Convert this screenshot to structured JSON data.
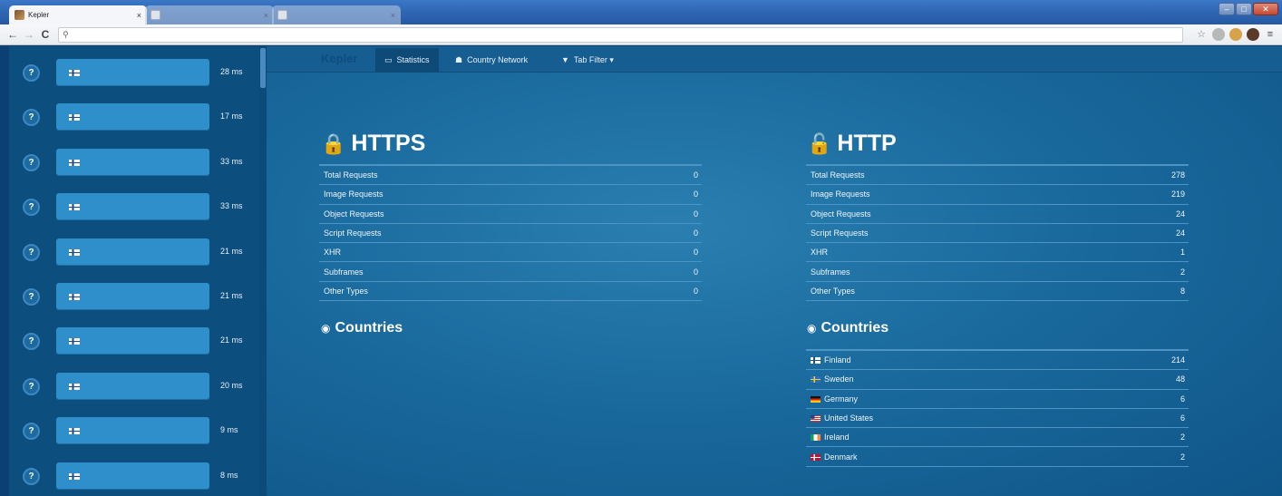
{
  "browser": {
    "tabs": [
      {
        "title": "Kepler",
        "close": "×"
      },
      {
        "title": "",
        "close": "×"
      },
      {
        "title": "",
        "close": "×"
      }
    ],
    "window_controls": {
      "minimize": "–",
      "maximize": "□",
      "close": "✕"
    },
    "nav": {
      "back": "←",
      "forward": "→",
      "reload": "C",
      "search_glyph": "⚲"
    },
    "toolbar_icons": {
      "star": "☆",
      "menu": "≡"
    }
  },
  "sidebar": {
    "help_glyph": "?",
    "requests": [
      {
        "time": "28 ms"
      },
      {
        "time": "17 ms"
      },
      {
        "time": "33 ms"
      },
      {
        "time": "33 ms"
      },
      {
        "time": "21 ms"
      },
      {
        "time": "21 ms"
      },
      {
        "time": "21 ms"
      },
      {
        "time": "20 ms"
      },
      {
        "time": "9 ms"
      },
      {
        "time": "8 ms"
      }
    ]
  },
  "navbar": {
    "brand": "Kepler",
    "tabs": [
      {
        "label": "Statistics",
        "icon": "▭"
      },
      {
        "label": "Country Network",
        "icon": "☗"
      },
      {
        "label": "Tab Filter ▾",
        "icon": "▼"
      }
    ]
  },
  "https": {
    "title": "HTTPS",
    "icon": "🔒",
    "rows": [
      {
        "label": "Total Requests",
        "value": "0"
      },
      {
        "label": "Image Requests",
        "value": "0"
      },
      {
        "label": "Object Requests",
        "value": "0"
      },
      {
        "label": "Script Requests",
        "value": "0"
      },
      {
        "label": "XHR",
        "value": "0"
      },
      {
        "label": "Subframes",
        "value": "0"
      },
      {
        "label": "Other Types",
        "value": "0"
      }
    ],
    "countries_title": "Countries",
    "countries_icon": "◉"
  },
  "http": {
    "title": "HTTP",
    "icon": "🔓",
    "rows": [
      {
        "label": "Total Requests",
        "value": "278"
      },
      {
        "label": "Image Requests",
        "value": "219"
      },
      {
        "label": "Object Requests",
        "value": "24"
      },
      {
        "label": "Script Requests",
        "value": "24"
      },
      {
        "label": "XHR",
        "value": "1"
      },
      {
        "label": "Subframes",
        "value": "2"
      },
      {
        "label": "Other Types",
        "value": "8"
      }
    ],
    "countries_title": "Countries",
    "countries_icon": "◉",
    "countries": [
      {
        "name": "Finland",
        "value": "214",
        "flag": "fi"
      },
      {
        "name": "Sweden",
        "value": "48",
        "flag": "se"
      },
      {
        "name": "Germany",
        "value": "6",
        "flag": "de"
      },
      {
        "name": "United States",
        "value": "6",
        "flag": "us"
      },
      {
        "name": "Ireland",
        "value": "2",
        "flag": "ie"
      },
      {
        "name": "Denmark",
        "value": "2",
        "flag": "dk"
      }
    ]
  }
}
